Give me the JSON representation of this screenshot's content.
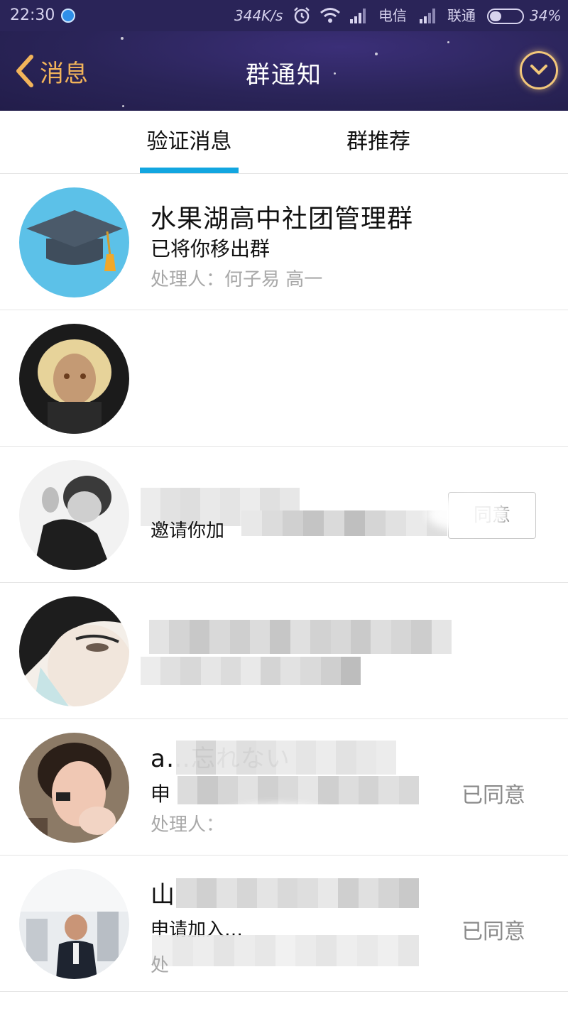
{
  "status_bar": {
    "time": "22:30",
    "net_speed": "344K/s",
    "carrier_1": "电信",
    "carrier_2": "联通",
    "battery": "34%"
  },
  "header": {
    "back_label": "消息",
    "title": "群通知",
    "menu_icon": "chevron-down-circle-icon"
  },
  "tabs": [
    {
      "label": "验证消息",
      "active": true
    },
    {
      "label": "群推荐",
      "active": false
    }
  ],
  "colors": {
    "header_bg": "#2a2458",
    "accent": "#f2b45a",
    "tab_indicator": "#12a6e0"
  },
  "notifications": [
    {
      "title": "水果湖高中社团管理群",
      "description": "已将你移出群",
      "handler": "处理人：何子易 高一",
      "status": "",
      "action": "",
      "avatar": "graduation-cap-avatar",
      "redacted": false
    },
    {
      "title": "",
      "description": "",
      "handler": "",
      "status": "",
      "action": "",
      "avatar": "illustrated-girl-avatar",
      "redacted": true
    },
    {
      "title": "",
      "description": "邀请你加",
      "handler": "",
      "status": "",
      "action": "同意",
      "avatar": "bw-photo-avatar",
      "redacted": true
    },
    {
      "title": "",
      "description": "",
      "handler": "",
      "status": "",
      "action": "",
      "avatar": "illustrated-face-avatar",
      "redacted": true
    },
    {
      "title": "a…忘れない",
      "description": "申",
      "handler": "处理人：",
      "status": "已同意",
      "action": "",
      "avatar": "photo-girl-avatar",
      "redacted": true
    },
    {
      "title": "山",
      "description": "申请加入…",
      "handler": "处",
      "status": "已同意",
      "action": "",
      "avatar": "photo-man-avatar",
      "redacted": true
    }
  ]
}
